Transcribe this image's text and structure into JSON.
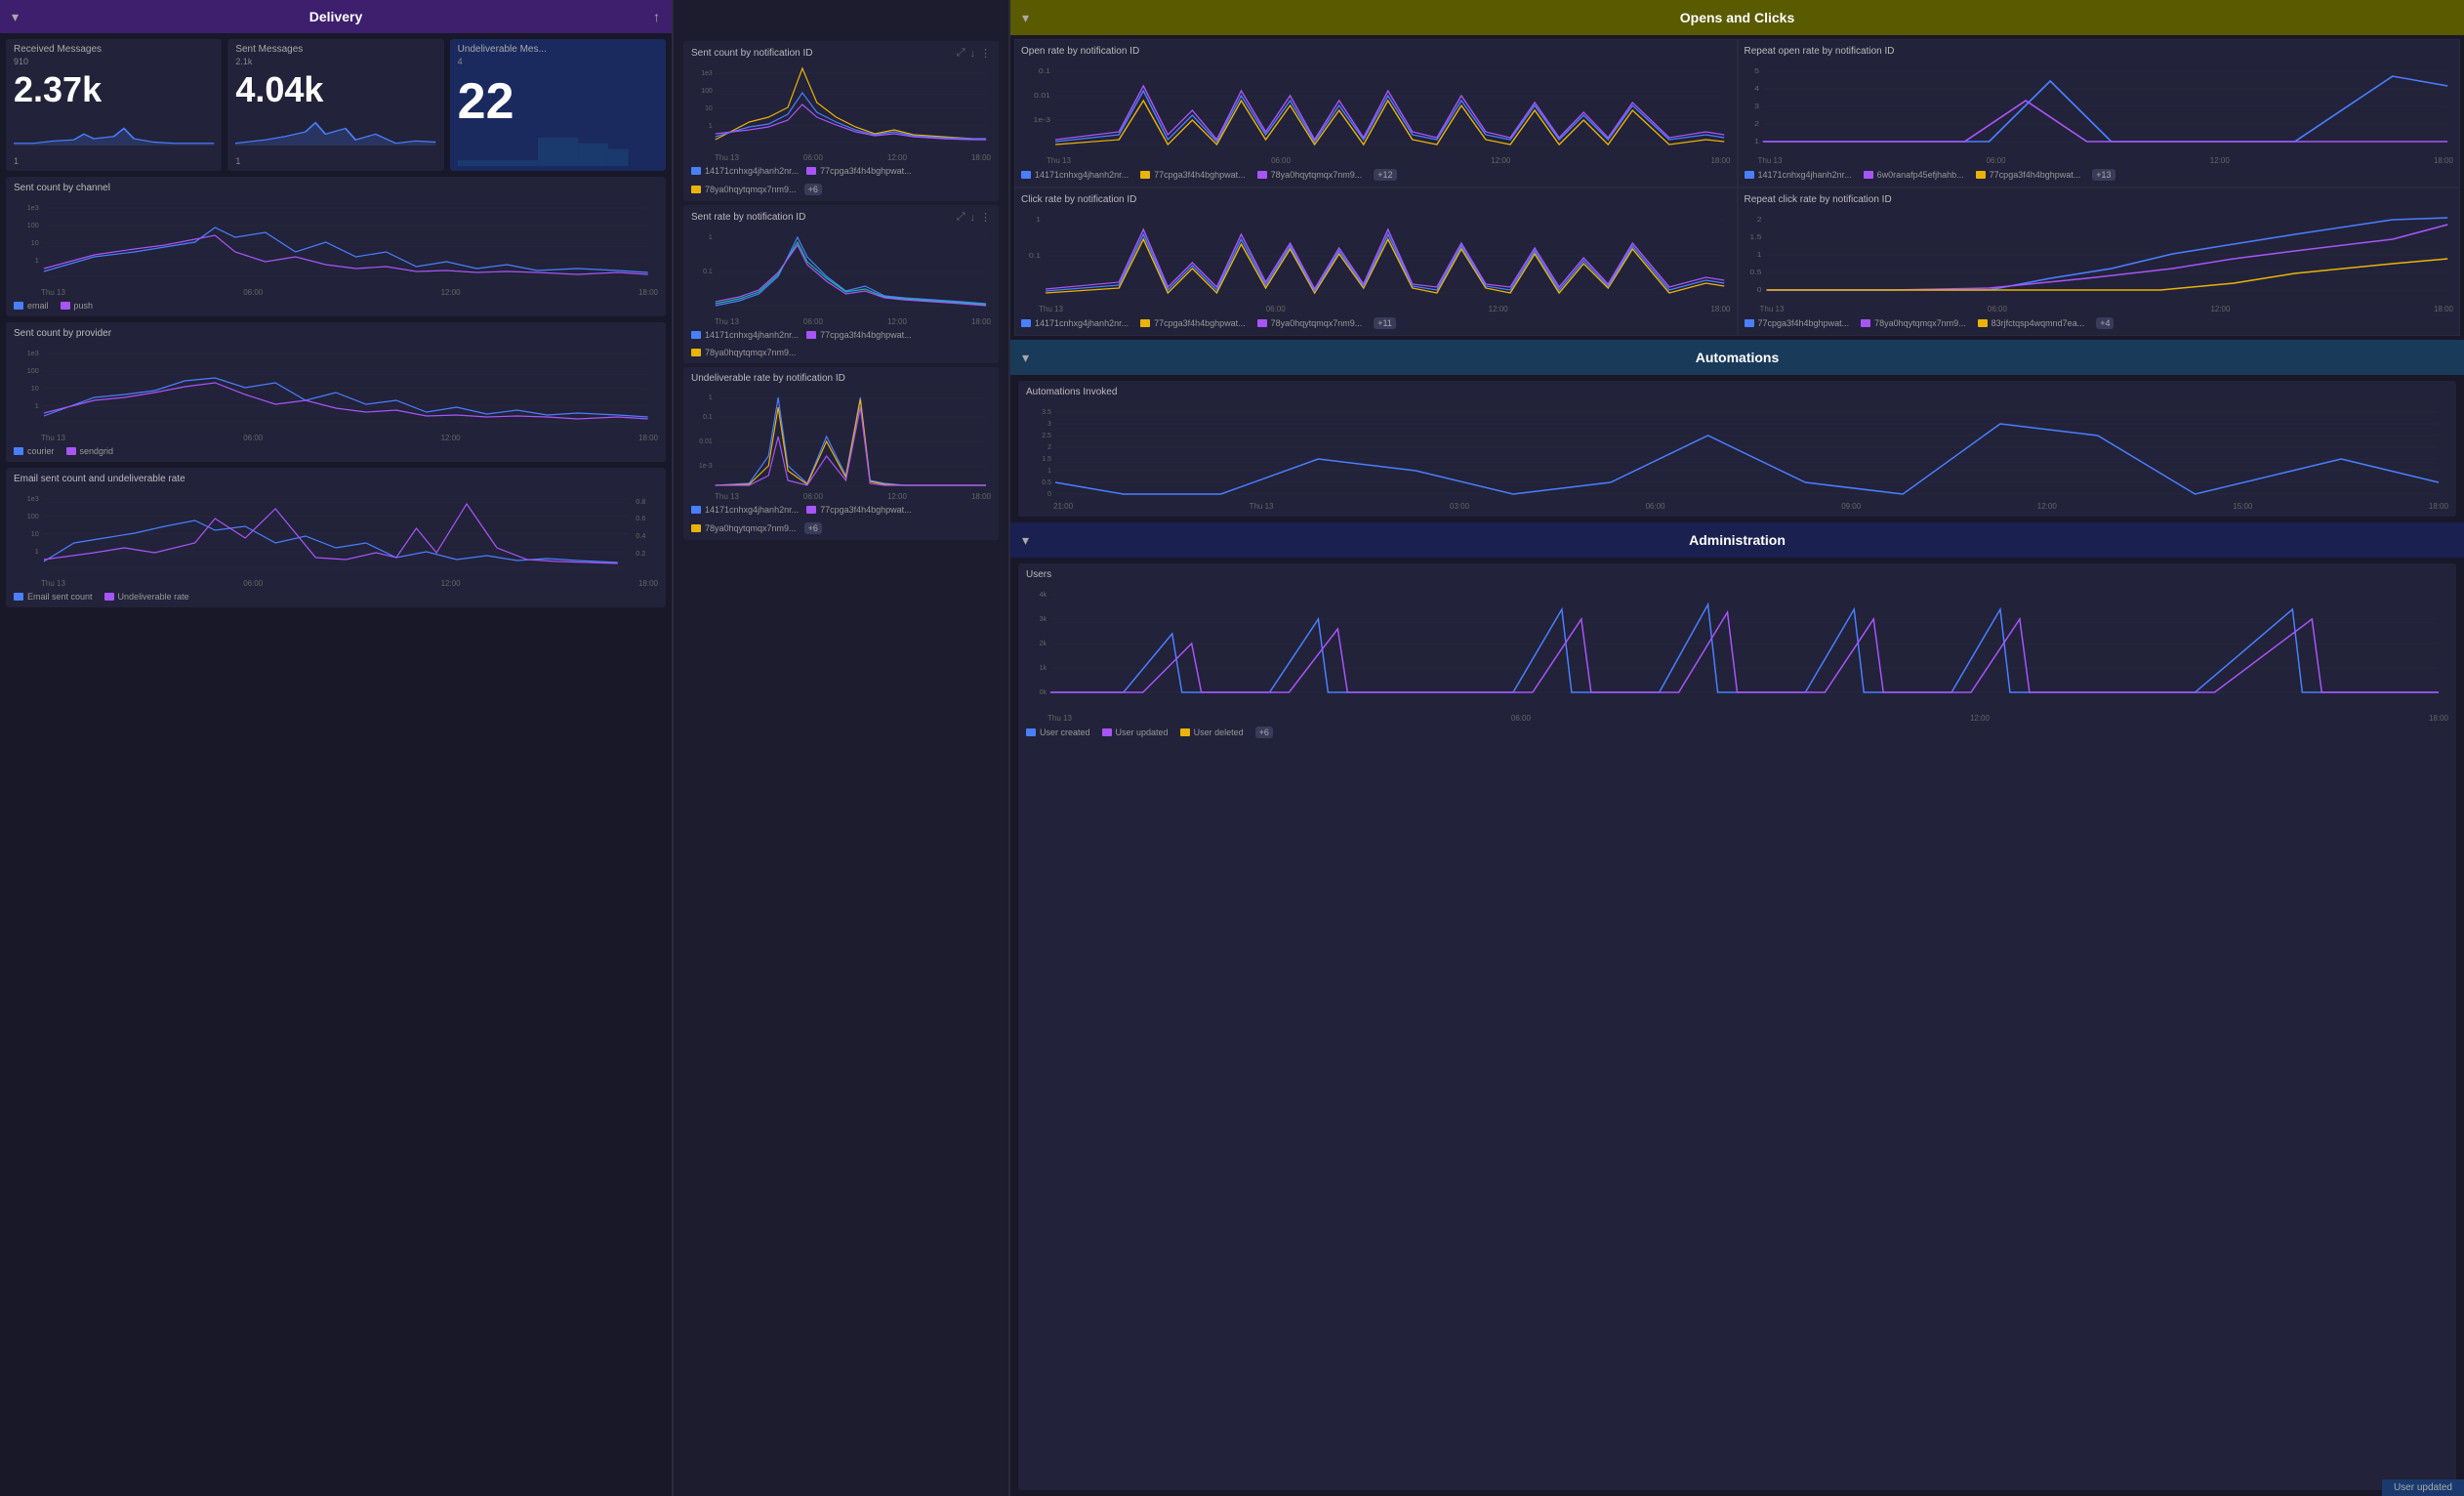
{
  "delivery": {
    "header_title": "Delivery",
    "metrics": {
      "received": {
        "label": "Received Messages",
        "value": "2.37k",
        "top": "910",
        "bottom": "1"
      },
      "sent": {
        "label": "Sent Messages",
        "value": "4.04k",
        "top": "2.1k",
        "bottom": "1"
      },
      "undeliverable": {
        "label": "Undeliverable Mes...",
        "value": "22",
        "top": "4",
        "bottom": ""
      }
    },
    "charts": {
      "sent_by_channel": {
        "title": "Sent count by channel",
        "legend": [
          {
            "label": "email",
            "color": "#4a7fff"
          },
          {
            "label": "push",
            "color": "#a855f7"
          }
        ],
        "x_labels": [
          "Thu 13",
          "06:00",
          "12:00",
          "18:00"
        ]
      },
      "sent_by_provider": {
        "title": "Sent count by provider",
        "legend": [
          {
            "label": "courier",
            "color": "#4a7fff"
          },
          {
            "label": "sendgrid",
            "color": "#a855f7"
          }
        ],
        "x_labels": [
          "Thu 13",
          "06:00",
          "12:00",
          "18:00"
        ]
      },
      "email_sent": {
        "title": "Email sent count and undeliverable rate",
        "legend": [
          {
            "label": "Email sent count",
            "color": "#4a7fff"
          },
          {
            "label": "Undeliverable rate",
            "color": "#a855f7"
          }
        ],
        "x_labels": [
          "Thu 13",
          "06:00",
          "12:00",
          "18:00"
        ],
        "y_right": [
          "0.8",
          "0.6",
          "0.4",
          "0.2"
        ]
      }
    }
  },
  "notification_charts": {
    "sent_count": {
      "title": "Sent count by notification ID",
      "badge": "+6",
      "legend": [
        {
          "label": "14171cnhxg4jhanh2nr...",
          "color": "#4a7fff"
        },
        {
          "label": "77cpga3f4h4bghpwat...",
          "color": "#a855f7"
        },
        {
          "label": "78ya0hqytqmqx7nm9...",
          "color": "#eab308"
        },
        {
          "label": "+6",
          "color": "#555"
        }
      ],
      "x_labels": [
        "Thu 13",
        "06:00",
        "12:00",
        "18:00"
      ],
      "y_labels": [
        "1e3",
        "100",
        "10",
        "1"
      ]
    },
    "sent_rate": {
      "title": "Sent rate by notification ID",
      "badge": "",
      "legend": [
        {
          "label": "14171cnhxg4jhanh2nr...",
          "color": "#4a7fff"
        },
        {
          "label": "77cpga3f4h4bghpwat...",
          "color": "#a855f7"
        },
        {
          "label": "78ya0hqytqmqx7nm9...",
          "color": "#eab308"
        }
      ],
      "x_labels": [
        "Thu 13",
        "06:00",
        "12:00",
        "18:00"
      ],
      "y_labels": [
        "1",
        "0.1"
      ]
    },
    "undeliverable_rate": {
      "title": "Undeliverable rate by notification ID",
      "badge": "+6",
      "legend": [
        {
          "label": "14171cnhxg4jhanh2nr...",
          "color": "#4a7fff"
        },
        {
          "label": "77cpga3f4h4bghpwat...",
          "color": "#a855f7"
        },
        {
          "label": "78ya0hqytqmqx7nm9...",
          "color": "#eab308"
        },
        {
          "label": "+6",
          "color": "#555"
        }
      ],
      "x_labels": [
        "Thu 13",
        "06:00",
        "12:00",
        "18:00"
      ],
      "y_labels": [
        "1",
        "0.1",
        "0.01",
        "1e-3"
      ]
    }
  },
  "opens_clicks": {
    "header_title": "Opens and Clicks",
    "open_rate": {
      "title": "Open rate by notification ID",
      "badge": "+12",
      "legend": [
        {
          "label": "14171cnhxg4jhanh2nr...",
          "color": "#4a7fff"
        },
        {
          "label": "77cpga3f4h4bghpwat...",
          "color": "#eab308"
        },
        {
          "label": "78ya0hqytqmqx7nm9...",
          "color": "#a855f7"
        },
        {
          "label": "+12",
          "color": "#555"
        }
      ],
      "x_labels": [
        "Thu 13",
        "06:00",
        "12:00",
        "18:00"
      ],
      "y_labels": [
        "0.1",
        "0.01",
        "1e-3"
      ]
    },
    "repeat_open_rate": {
      "title": "Repeat open rate by notification ID",
      "badge": "+13",
      "legend": [
        {
          "label": "14171cnhxg4jhanh2nr...",
          "color": "#4a7fff"
        },
        {
          "label": "6w0ranafp45efjhahb...",
          "color": "#a855f7"
        },
        {
          "label": "77cpga3f4h4bghpwat...",
          "color": "#eab308"
        },
        {
          "label": "+13",
          "color": "#555"
        }
      ],
      "x_labels": [
        "Thu 13",
        "06:00",
        "12:00",
        "18:00"
      ],
      "y_labels": [
        "5",
        "4",
        "3",
        "2",
        "1"
      ]
    },
    "click_rate": {
      "title": "Click rate by notification ID",
      "badge": "+11",
      "legend": [
        {
          "label": "14171cnhxg4jhanh2nr...",
          "color": "#4a7fff"
        },
        {
          "label": "77cpga3f4h4bghpwat...",
          "color": "#eab308"
        },
        {
          "label": "78ya0hqytqmqx7nm9...",
          "color": "#a855f7"
        },
        {
          "label": "+11",
          "color": "#555"
        }
      ],
      "x_labels": [
        "Thu 13",
        "06:00",
        "12:00",
        "18:00"
      ],
      "y_labels": [
        "1",
        "0.1"
      ]
    },
    "repeat_click_rate": {
      "title": "Repeat click rate by notification ID",
      "badge": "+4",
      "legend": [
        {
          "label": "77cpga3f4h4bghpwat...",
          "color": "#4a7fff"
        },
        {
          "label": "78ya0hqytqmqx7nm9...",
          "color": "#a855f7"
        },
        {
          "label": "83rjfctqsp4wqmnd7ea...",
          "color": "#eab308"
        },
        {
          "label": "+4",
          "color": "#555"
        }
      ],
      "x_labels": [
        "Thu 13",
        "06:00",
        "12:00",
        "18:00"
      ],
      "y_labels": [
        "2",
        "1.5",
        "1",
        "0.5",
        "0"
      ]
    }
  },
  "automations": {
    "header_title": "Automations",
    "invoked": {
      "title": "Automations Invoked",
      "x_labels": [
        "21:00",
        "Thu 13",
        "03:00",
        "06:00",
        "09:00",
        "12:00",
        "15:00",
        "18:00"
      ],
      "y_labels": [
        "3.5",
        "3",
        "2.5",
        "2",
        "1.5",
        "1",
        "0.5",
        "0"
      ]
    }
  },
  "administration": {
    "header_title": "Administration",
    "users": {
      "title": "Users",
      "legend": [
        {
          "label": "User created",
          "color": "#4a7fff"
        },
        {
          "label": "User updated",
          "color": "#a855f7"
        },
        {
          "label": "User deleted",
          "color": "#eab308"
        },
        {
          "label": "+6",
          "color": "#555"
        }
      ],
      "x_labels": [
        "Thu 13",
        "06:00",
        "12:00",
        "18:00"
      ],
      "y_labels": [
        "4k",
        "3k",
        "2k",
        "1k",
        "0k"
      ]
    }
  },
  "status_bar": {
    "text": "User updated"
  },
  "icons": {
    "chevron_down": "▾",
    "upload": "↑",
    "expand": "⤢",
    "more": "⋯"
  }
}
